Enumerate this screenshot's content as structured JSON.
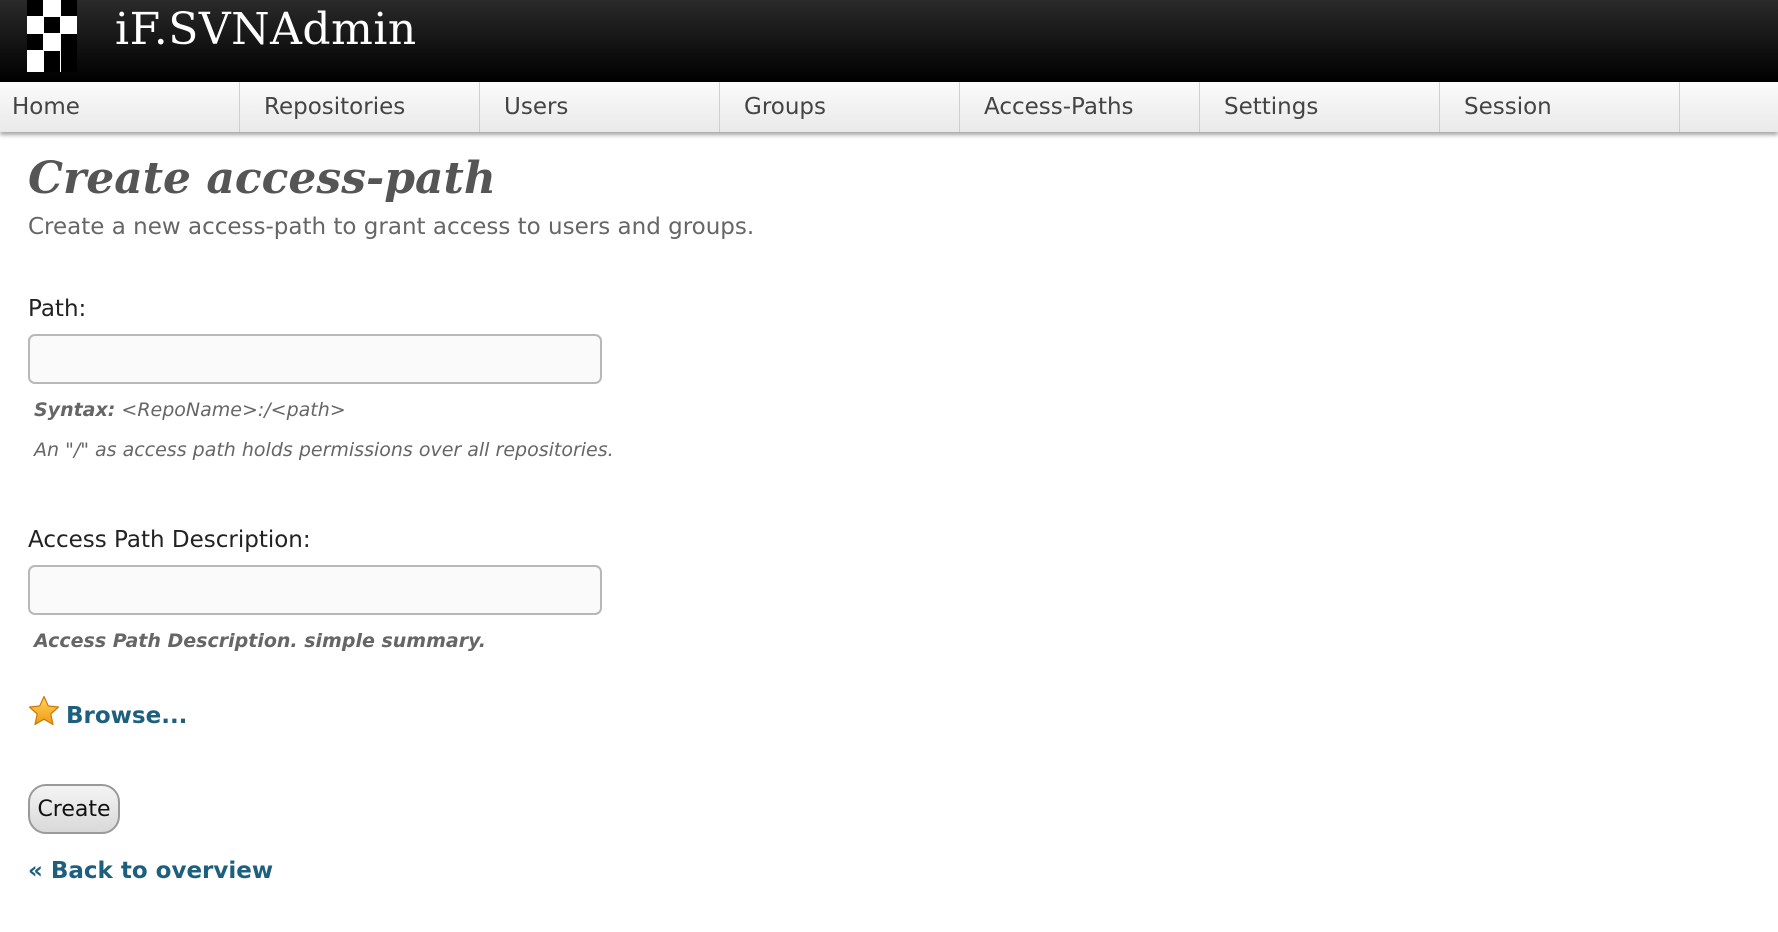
{
  "header": {
    "app_title": "iF.SVNAdmin",
    "logo_icon": "if-logo-icon"
  },
  "nav": {
    "items": [
      {
        "label": "Home"
      },
      {
        "label": "Repositories"
      },
      {
        "label": "Users"
      },
      {
        "label": "Groups"
      },
      {
        "label": "Access-Paths"
      },
      {
        "label": "Settings"
      },
      {
        "label": "Session"
      }
    ]
  },
  "page": {
    "title": "Create access-path",
    "description": "Create a new access-path to grant access to users and groups."
  },
  "form": {
    "path": {
      "label": "Path:",
      "value": "",
      "syntax_label": "Syntax:",
      "syntax_value": "<RepoName>:/<path>",
      "hint": "An \"/\" as access path holds permissions over all repositories."
    },
    "description": {
      "label": "Access Path Description:",
      "value": "",
      "hint": "Access Path Description. simple summary."
    },
    "browse": {
      "label": "Browse...",
      "icon": "star-icon"
    },
    "create_label": "Create",
    "back_label": "« Back to overview"
  },
  "colors": {
    "header_bg": "#000000",
    "link": "#1d5f7e",
    "star": "#f5a623"
  }
}
